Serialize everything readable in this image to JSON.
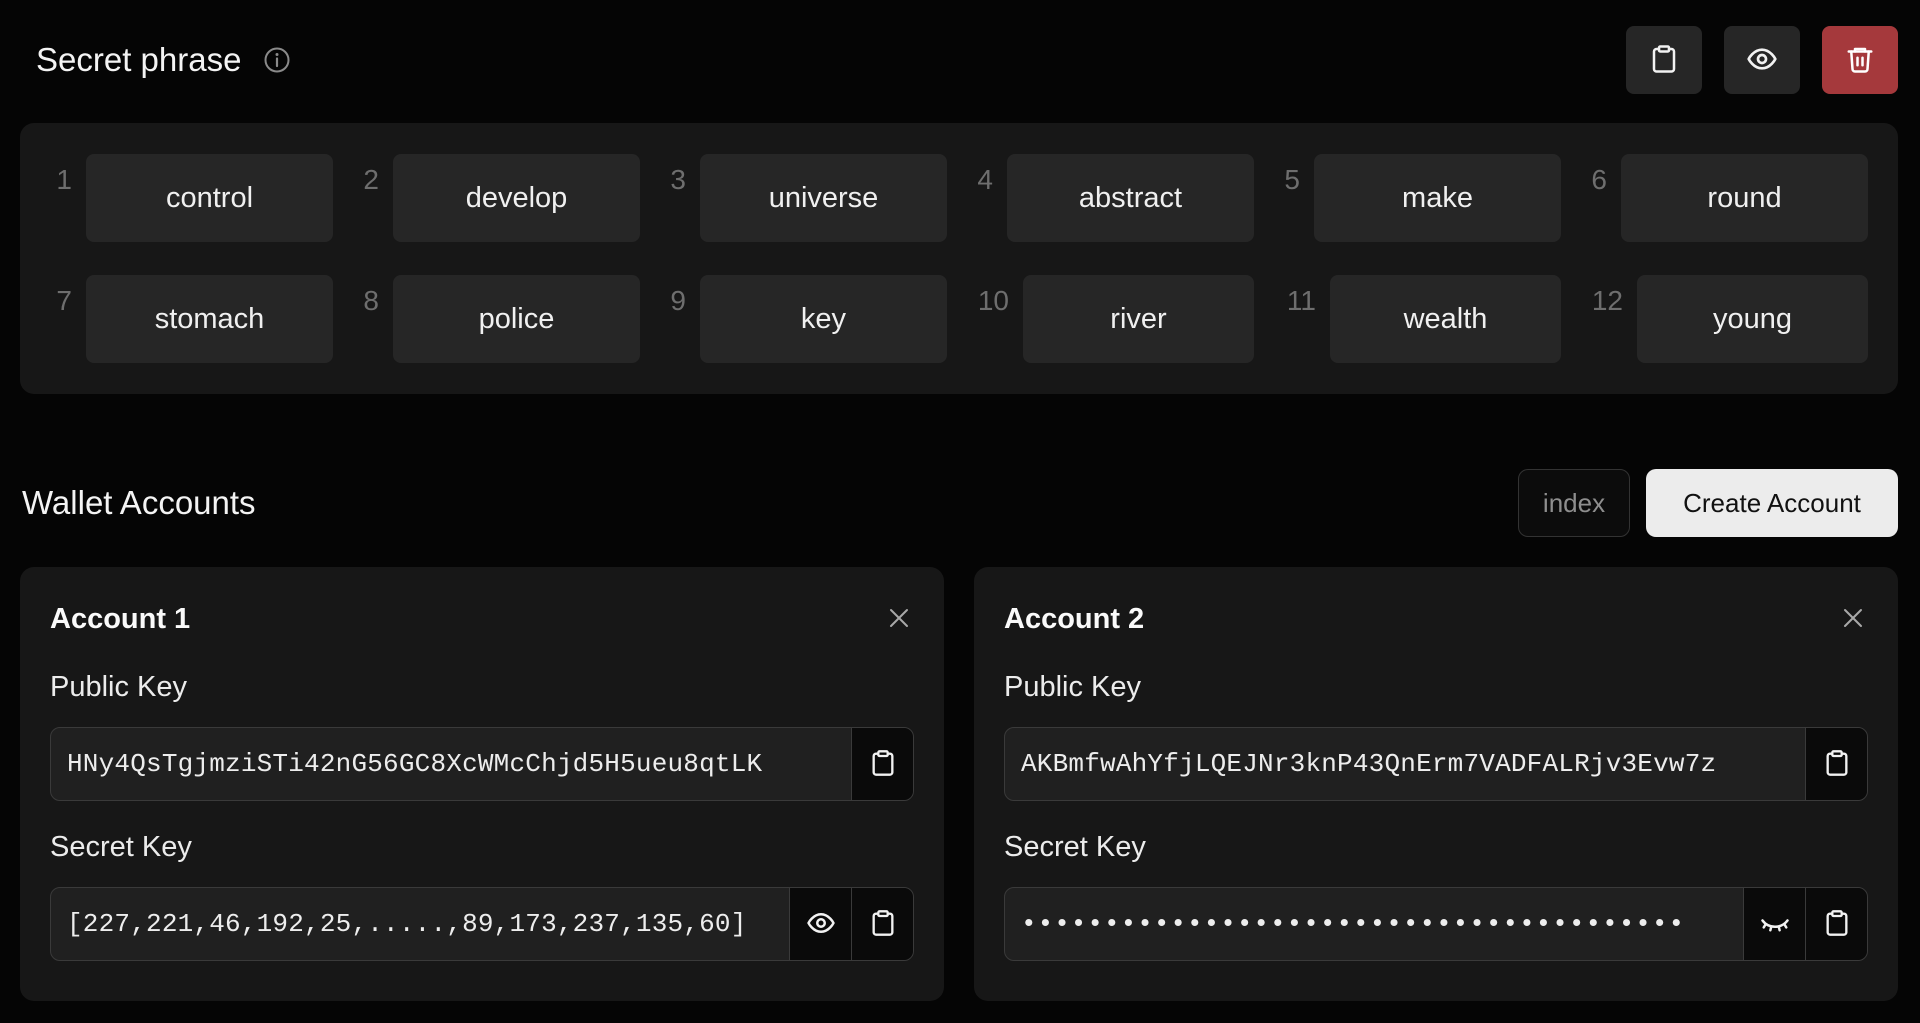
{
  "header": {
    "title": "Secret phrase",
    "icons": {
      "info": "info-icon",
      "copy": "clipboard-icon",
      "reveal": "eye-icon",
      "delete": "trash-icon"
    },
    "colors": {
      "danger": "#a5393c"
    }
  },
  "phrase": {
    "words": [
      {
        "index": "1",
        "word": "control"
      },
      {
        "index": "2",
        "word": "develop"
      },
      {
        "index": "3",
        "word": "universe"
      },
      {
        "index": "4",
        "word": "abstract"
      },
      {
        "index": "5",
        "word": "make"
      },
      {
        "index": "6",
        "word": "round"
      },
      {
        "index": "7",
        "word": "stomach"
      },
      {
        "index": "8",
        "word": "police"
      },
      {
        "index": "9",
        "word": "key"
      },
      {
        "index": "10",
        "word": "river"
      },
      {
        "index": "11",
        "word": "wealth"
      },
      {
        "index": "12",
        "word": "young"
      }
    ]
  },
  "accounts_section": {
    "title": "Wallet Accounts",
    "index_placeholder": "index",
    "create_label": "Create Account"
  },
  "accounts": [
    {
      "title": "Account 1",
      "public_key_label": "Public Key",
      "public_key": "HNy4QsTgjmziSTi42nG56GC8XcWMcChjd5H5ueu8qtLK",
      "secret_key_label": "Secret Key",
      "secret_key": "[227,221,46,192,25,.....,89,173,237,135,60]",
      "secret_visible_icon": "eye-icon"
    },
    {
      "title": "Account 2",
      "public_key_label": "Public Key",
      "public_key": "AKBmfwAhYfjLQEJNr3knP43QnErm7VADFALRjv3Evw7z",
      "secret_key_label": "Secret Key",
      "secret_key": "••••••••••••••••••••••••••••••••••••••••",
      "secret_visible_icon": "eye-closed-icon"
    }
  ]
}
